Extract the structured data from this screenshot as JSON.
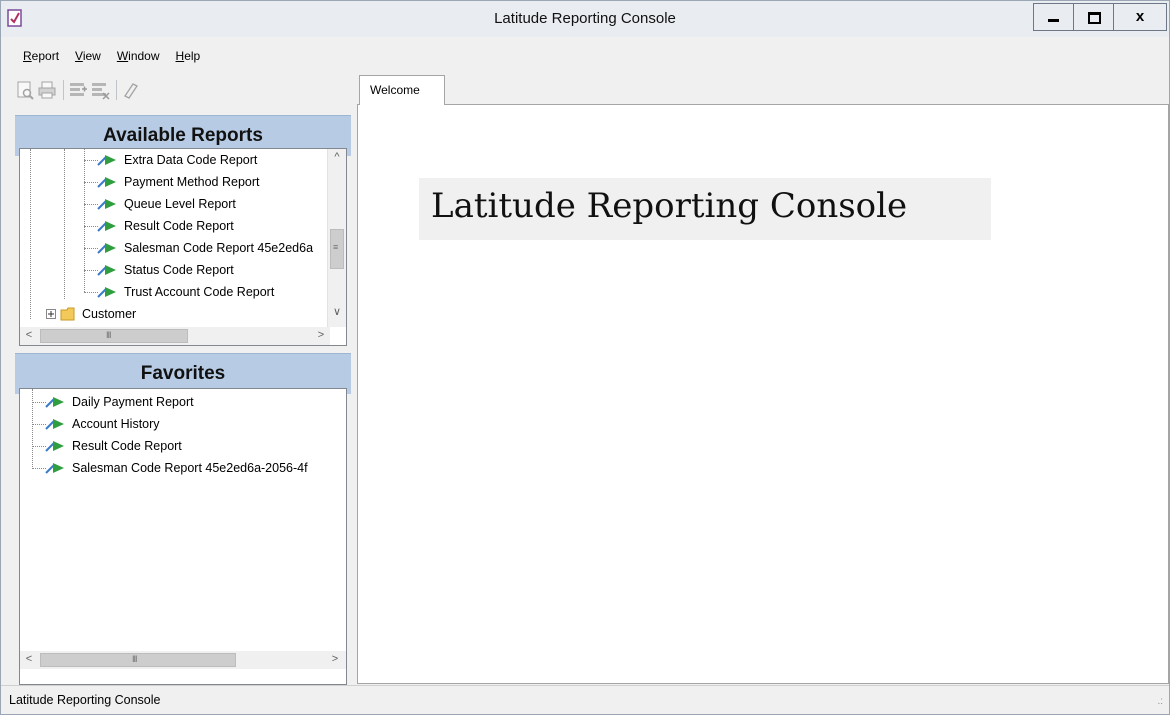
{
  "window": {
    "title": "Latitude Reporting Console"
  },
  "menu": [
    "Report",
    "View",
    "Window",
    "Help"
  ],
  "toolbar": [
    "print-preview-icon",
    "print-icon",
    "add-favorite-icon",
    "remove-favorite-icon",
    "clear-icon"
  ],
  "available_reports": {
    "title": "Available Reports",
    "items": [
      "Extra Data Code Report",
      "Payment Method Report",
      "Queue Level Report",
      "Result Code Report",
      "Salesman Code Report 45e2ed6a",
      "Status Code Report",
      "Trust Account Code Report"
    ],
    "folder": "Customer",
    "scroll_glyph": "III"
  },
  "favorites": {
    "title": "Favorites",
    "items": [
      "Daily Payment Report",
      "Account History",
      "Result Code Report",
      "Salesman Code Report 45e2ed6a-2056-4f"
    ],
    "scroll_glyph": "III"
  },
  "tabs": [
    {
      "label": "Welcome",
      "active": true
    }
  ],
  "welcome": {
    "heading": "Latitude Reporting Console"
  },
  "status": {
    "text": "Latitude Reporting Console",
    "grip": ".:"
  },
  "colors": {
    "pane_header": "#b7cce4",
    "title_bar": "#e9ecf0",
    "report_icon": "#2e9e3e"
  }
}
